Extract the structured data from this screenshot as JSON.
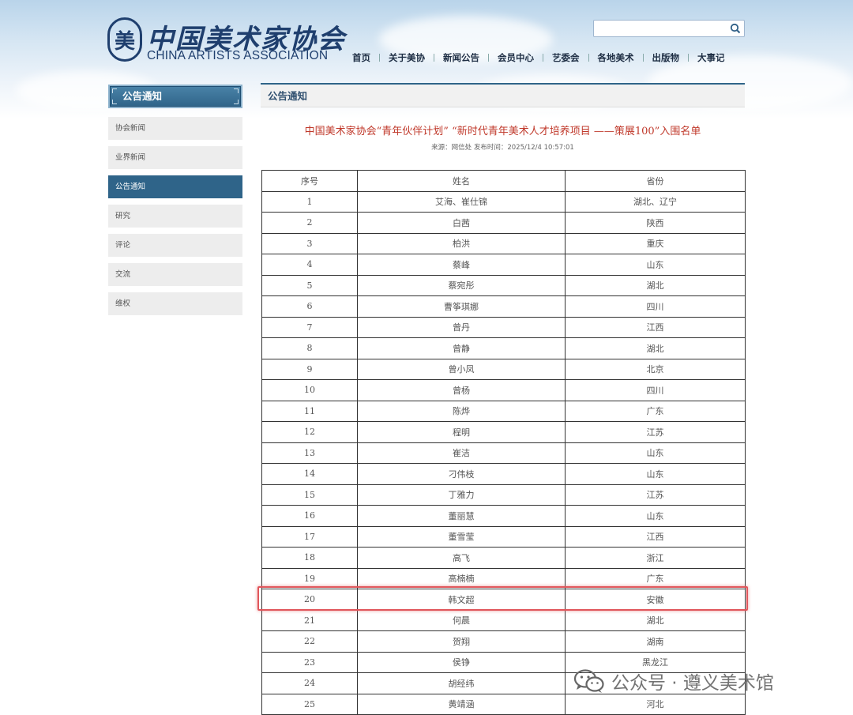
{
  "header": {
    "logo_cn": "中国美术家协会",
    "logo_en": "CHINA ARTISTS ASSOCIATION",
    "logo_emblem": "美",
    "search": {
      "value": "",
      "placeholder": ""
    },
    "nav": [
      "首页",
      "关于美协",
      "新闻公告",
      "会员中心",
      "艺委会",
      "各地美术",
      "出版物",
      "大事记"
    ]
  },
  "sidebar": {
    "heading": "公告通知",
    "items": [
      {
        "label": "协会新闻",
        "active": false
      },
      {
        "label": "业界新闻",
        "active": false
      },
      {
        "label": "公告通知",
        "active": true
      },
      {
        "label": "研究",
        "active": false
      },
      {
        "label": "评论",
        "active": false
      },
      {
        "label": "交流",
        "active": false
      },
      {
        "label": "维权",
        "active": false
      }
    ]
  },
  "main": {
    "section_title": "公告通知",
    "article_title": "中国美术家协会“青年伙伴计划” “新时代青年美术人才培养项目 ——策展100”入围名单",
    "article_meta": "来源：网信处 发布时间：2025/12/4 10:57:01",
    "table": {
      "headers": [
        "序号",
        "姓名",
        "省份"
      ],
      "rows": [
        [
          "1",
          "艾海、崔仕锦",
          "湖北、辽宁"
        ],
        [
          "2",
          "白茜",
          "陕西"
        ],
        [
          "3",
          "柏洪",
          "重庆"
        ],
        [
          "4",
          "蔡峰",
          "山东"
        ],
        [
          "5",
          "蔡宛彤",
          "湖北"
        ],
        [
          "6",
          "曹筝琪娜",
          "四川"
        ],
        [
          "7",
          "曾丹",
          "江西"
        ],
        [
          "8",
          "曾静",
          "湖北"
        ],
        [
          "9",
          "曾小凤",
          "北京"
        ],
        [
          "10",
          "曾杨",
          "四川"
        ],
        [
          "11",
          "陈烨",
          "广东"
        ],
        [
          "12",
          "程明",
          "江苏"
        ],
        [
          "13",
          "崔洁",
          "山东"
        ],
        [
          "14",
          "刁伟枝",
          "山东"
        ],
        [
          "15",
          "丁雅力",
          "江苏"
        ],
        [
          "16",
          "董丽慧",
          "山东"
        ],
        [
          "17",
          "董雪莹",
          "江西"
        ],
        [
          "18",
          "高飞",
          "浙江"
        ],
        [
          "19",
          "高楠楠",
          "广东"
        ],
        [
          "20",
          "韩文超",
          "安徽"
        ],
        [
          "21",
          "何晨",
          "湖北"
        ],
        [
          "22",
          "贺翔",
          "湖南"
        ],
        [
          "23",
          "侯铮",
          "黑龙江"
        ],
        [
          "24",
          "胡经纬",
          ""
        ],
        [
          "25",
          "黄靖涵",
          "河北"
        ]
      ],
      "highlighted_row": "20"
    }
  },
  "watermark": "公众号 · 遵义美术馆",
  "colors": {
    "brand_blue": "#1f3f6e",
    "sidebar_active": "#2f6489",
    "title_red": "#c0392b",
    "highlight_red": "#e0565b"
  },
  "icons": {
    "search": "search-icon",
    "watermark": "wechat-icon"
  }
}
